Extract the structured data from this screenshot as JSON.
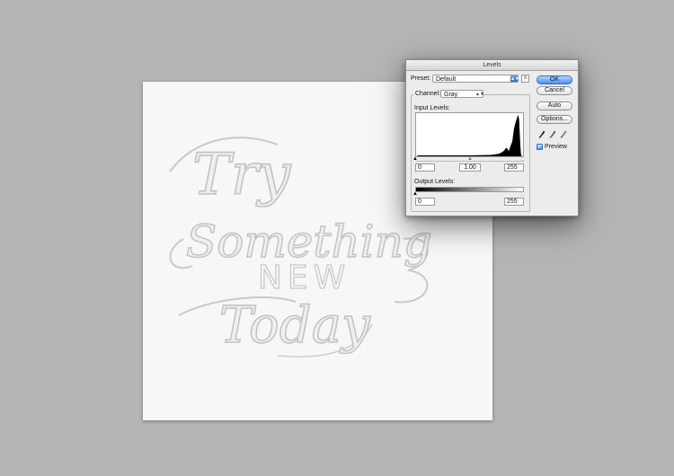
{
  "canvas": {
    "lettering": [
      "Try",
      "Something",
      "NEW",
      "Today"
    ]
  },
  "levels_dialog": {
    "title": "Levels",
    "preset_label": "Preset:",
    "preset_value": "Default",
    "channel_label": "Channel:",
    "channel_value": "Gray",
    "input_levels_label": "Input Levels:",
    "input_black": "0",
    "input_gamma": "1.00",
    "input_white": "255",
    "output_levels_label": "Output Levels:",
    "output_black": "0",
    "output_white": "255",
    "buttons": {
      "ok": "OK",
      "cancel": "Cancel",
      "auto": "Auto",
      "options": "Options..."
    },
    "preview_label": "Preview",
    "preview_checked": true,
    "eyedroppers": [
      "black-eyedropper-icon",
      "gray-eyedropper-icon",
      "white-eyedropper-icon"
    ],
    "accent_color": "#4a8ff0"
  }
}
